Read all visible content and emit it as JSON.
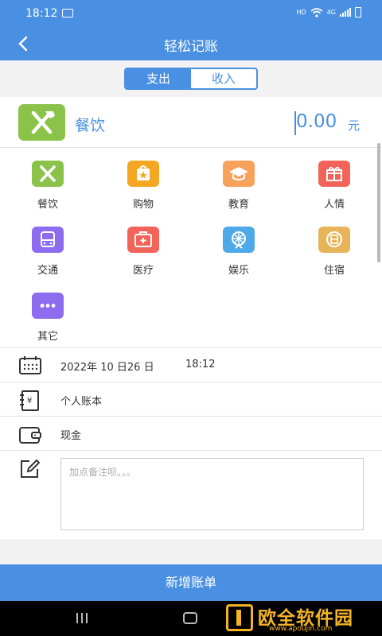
{
  "status_bar": {
    "time": "18:12",
    "network_label": "HD",
    "signal_type": "4G"
  },
  "header": {
    "title": "轻松记账",
    "back_icon": "chevron-left-icon"
  },
  "tabs": [
    {
      "label": "支出",
      "active": true
    },
    {
      "label": "收入",
      "active": false
    }
  ],
  "selected": {
    "name": "餐饮",
    "amount": "0.00",
    "unit": "元",
    "icon": "fork-knife-icon"
  },
  "categories": [
    {
      "label": "餐饮",
      "icon": "fork-knife-icon",
      "color": "#8bc34a"
    },
    {
      "label": "购物",
      "icon": "shopping-bag-icon",
      "color": "#f5a623"
    },
    {
      "label": "教育",
      "icon": "graduation-cap-icon",
      "color": "#f7a15a"
    },
    {
      "label": "人情",
      "icon": "gift-icon",
      "color": "#f2645a"
    },
    {
      "label": "交通",
      "icon": "bus-icon",
      "color": "#8d6cf0"
    },
    {
      "label": "医疗",
      "icon": "medical-kit-icon",
      "color": "#f2645a"
    },
    {
      "label": "娱乐",
      "icon": "ferris-wheel-icon",
      "color": "#4fa8e8"
    },
    {
      "label": "住宿",
      "icon": "hotel-icon",
      "color": "#e8b45a"
    },
    {
      "label": "其它",
      "icon": "more-icon",
      "color": "#8d6cf0"
    }
  ],
  "date_row": {
    "date": "2022年 10 日26 日",
    "time": "18:12",
    "icon": "calendar-icon"
  },
  "account_book_row": {
    "label": "个人账本",
    "icon": "ledger-icon"
  },
  "payment_row": {
    "label": "现金",
    "icon": "wallet-icon"
  },
  "note": {
    "placeholder": "加点备注呗。。。",
    "icon": "edit-icon"
  },
  "submit_button": "新增账单",
  "watermark": {
    "name": "欧全软件园",
    "url": "www.apoujin.com"
  },
  "colors": {
    "primary": "#4a90e2",
    "background": "#f2f2f2",
    "accent_watermark": "#f3b324"
  }
}
